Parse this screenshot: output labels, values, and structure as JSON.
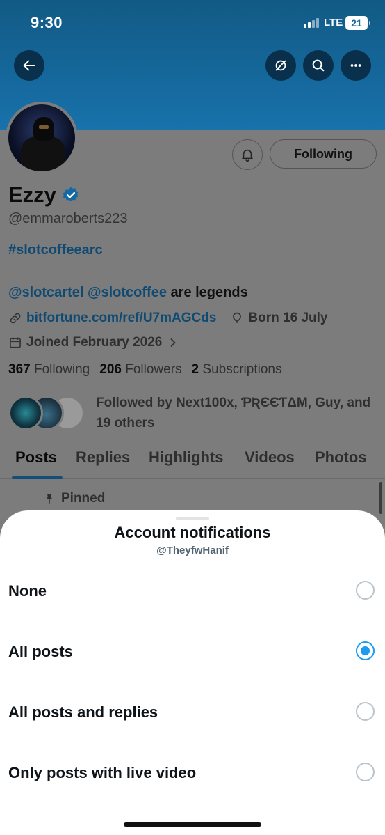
{
  "status_bar": {
    "time": "9:30",
    "network": "LTE",
    "battery": "21"
  },
  "profile": {
    "name": "Ezzy",
    "handle": "@emmaroberts223",
    "hashtag": "#slotcoffeearc",
    "bio_mention1": "@slotcartel",
    "bio_mention2": "@slotcoffee",
    "bio_rest": "are legends",
    "link": "bitfortune.com/ref/U7mAGCds",
    "born": "Born 16 July",
    "joined": "Joined February 2026",
    "following_count": "367",
    "following_label": "Following",
    "followers_count": "206",
    "followers_label": "Followers",
    "subscriptions_count": "2",
    "subscriptions_label": "Subscriptions",
    "followed_by": "Followed by Next100x, ƤƦЄЄƬΔM, Guy, and 19 others",
    "following_button": "Following"
  },
  "tabs": [
    "Posts",
    "Replies",
    "Highlights",
    "Videos",
    "Photos"
  ],
  "pinned_label": "Pinned",
  "sheet": {
    "title": "Account notifications",
    "subtitle": "@TheyfwHanif",
    "options": [
      {
        "label": "None",
        "selected": false
      },
      {
        "label": "All posts",
        "selected": true
      },
      {
        "label": "All posts and replies",
        "selected": false
      },
      {
        "label": "Only posts with live video",
        "selected": false
      }
    ]
  },
  "colors": {
    "accent": "#1d9bf0",
    "banner": "#15689c"
  }
}
